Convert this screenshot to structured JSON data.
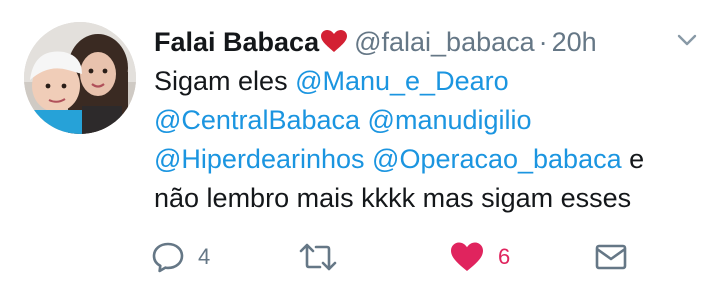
{
  "tweet": {
    "display_name": "Falai Babaca",
    "handle": "@falai_babaca",
    "separator": "·",
    "time": "20h",
    "lines": [
      [
        {
          "t": "Sigam eles ",
          "m": false
        },
        {
          "t": "@Manu_e_Dearo",
          "m": true
        }
      ],
      [
        {
          "t": "@CentralBabaca",
          "m": true
        },
        {
          "t": " ",
          "m": false
        },
        {
          "t": "@manudigilio",
          "m": true
        }
      ],
      [
        {
          "t": "@Hiperdearinhos",
          "m": true
        },
        {
          "t": " ",
          "m": false
        },
        {
          "t": "@Operacao_babaca",
          "m": true
        },
        {
          "t": " e",
          "m": false
        }
      ],
      [
        {
          "t": "não lembro mais kkkk mas sigam esses",
          "m": false
        }
      ]
    ],
    "actions": {
      "reply": {
        "icon": "reply-icon",
        "count": "4"
      },
      "retweet": {
        "icon": "retweet-icon",
        "count": ""
      },
      "like": {
        "icon": "heart-filled-icon",
        "count": "6",
        "liked": true
      },
      "dm": {
        "icon": "envelope-icon",
        "count": ""
      }
    }
  },
  "colors": {
    "link": "#1b95e0",
    "secondary_text": "#657786",
    "primary_text": "#14171a",
    "like": "#e0245e"
  },
  "icons": {
    "name_emoji": "red-heart-emoji",
    "caret": "chevron-down-icon"
  }
}
